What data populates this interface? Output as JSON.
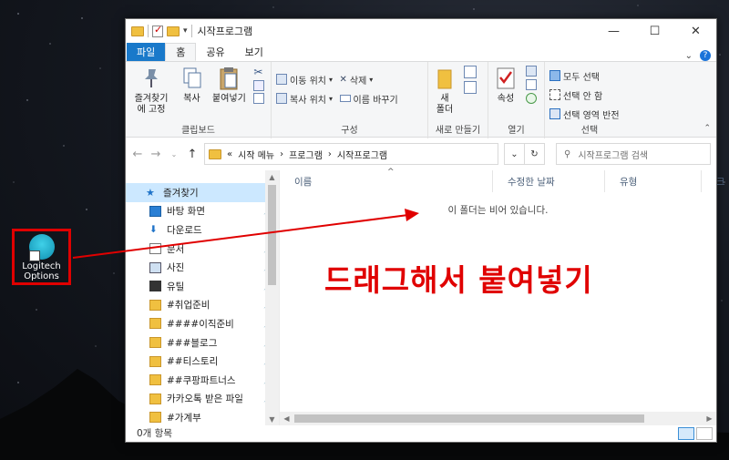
{
  "desktop": {
    "icon_label_line1": "Logitech",
    "icon_label_line2": "Options"
  },
  "window": {
    "title": "시작프로그램",
    "minimize_glyph": "—",
    "maximize_glyph": "☐",
    "close_glyph": "✕"
  },
  "ribbon_tabs": [
    "파일",
    "홈",
    "공유",
    "보기"
  ],
  "ribbon": {
    "clipboard": {
      "pin_label": "즐겨찾기에 고정",
      "copy_label": "복사",
      "paste_label": "붙여넣기",
      "group_name": "클립보드"
    },
    "organize": {
      "move_to": "이동 위치",
      "copy_to": "복사 위치",
      "delete": "삭제",
      "rename": "이름 바꾸기",
      "group_name": "구성"
    },
    "new": {
      "new_folder": "새 폴더",
      "group_name": "새로 만들기"
    },
    "open": {
      "properties": "속성",
      "group_name": "열기"
    },
    "select": {
      "select_all": "모두 선택",
      "select_none": "선택 안 함",
      "invert": "선택 영역 반전",
      "group_name": "선택"
    }
  },
  "address": {
    "path": [
      "«",
      "시작 메뉴",
      "프로그램",
      "시작프로그램"
    ],
    "search_placeholder": "시작프로그램 검색"
  },
  "nav_items": [
    {
      "label": "즐겨찾기",
      "icon": "star-icon",
      "pinned": false
    },
    {
      "label": "바탕 화면",
      "icon": "desktop-icon",
      "pinned": true
    },
    {
      "label": "다운로드",
      "icon": "download-icon",
      "pinned": true
    },
    {
      "label": "문서",
      "icon": "document-icon",
      "pinned": true
    },
    {
      "label": "사진",
      "icon": "pictures-icon",
      "pinned": true
    },
    {
      "label": "유틸",
      "icon": "utility-icon",
      "pinned": true
    },
    {
      "label": "#취업준비",
      "icon": "folder-icon",
      "pinned": true
    },
    {
      "label": "####이직준비",
      "icon": "folder-icon",
      "pinned": true
    },
    {
      "label": "###블로그",
      "icon": "folder-icon",
      "pinned": true
    },
    {
      "label": "##티스토리",
      "icon": "folder-icon",
      "pinned": true
    },
    {
      "label": "##쿠팡파트너스",
      "icon": "folder-icon",
      "pinned": true
    },
    {
      "label": "카카오톡 받은 파일",
      "icon": "folder-icon",
      "pinned": true
    },
    {
      "label": "#가계부",
      "icon": "folder-icon",
      "pinned": false
    }
  ],
  "columns": [
    "이름",
    "수정한 날짜",
    "유형",
    "크"
  ],
  "empty_message": "이 폴더는 비어 있습니다.",
  "status_text": "0개 항목",
  "annotation": "드래그해서 붙여넣기",
  "colors": {
    "annotation": "#e00000",
    "file_tab": "#1979ca",
    "folder": "#f0c040"
  }
}
